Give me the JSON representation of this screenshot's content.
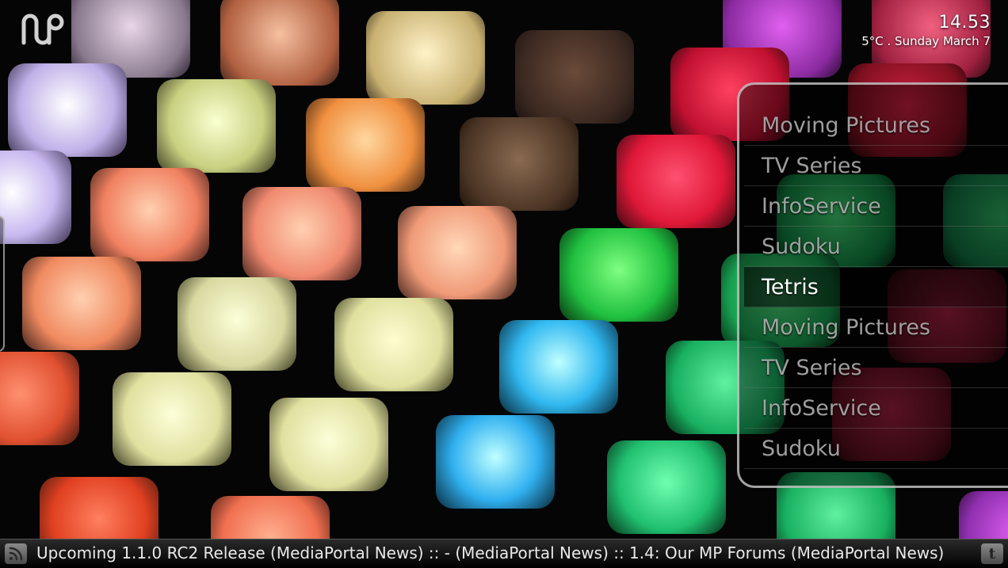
{
  "header": {
    "time": "14.53",
    "weather_date": "5°C  .  Sunday March 7",
    "logo_icon": "mediaportal-logo-icon"
  },
  "menu": {
    "items": [
      {
        "label": "Moving Pictures",
        "selected": false
      },
      {
        "label": "TV Series",
        "selected": false
      },
      {
        "label": "InfoService",
        "selected": false
      },
      {
        "label": "Sudoku",
        "selected": false
      },
      {
        "label": "Tetris",
        "selected": true
      },
      {
        "label": "Moving Pictures",
        "selected": false
      },
      {
        "label": "TV Series",
        "selected": false
      },
      {
        "label": "InfoService",
        "selected": false
      },
      {
        "label": "Sudoku",
        "selected": false
      }
    ]
  },
  "ticker": {
    "rss_icon": "rss-icon",
    "text": "Upcoming 1.1.0 RC2 Release (MediaPortal News) :: - (MediaPortal News) :: 1.4: Our MP Forums (MediaPortal News)",
    "twitter_icon": "twitter-icon",
    "twitter_glyph": "t"
  },
  "colors": {
    "selected_text": "#ffffff",
    "unselected_text": "#d2d2d2",
    "frame": "#d7d7d7"
  }
}
